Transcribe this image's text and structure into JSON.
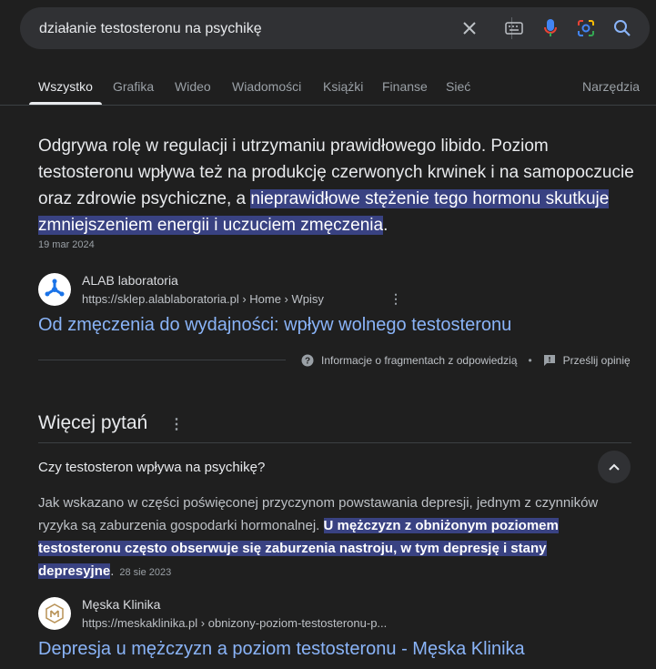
{
  "search": {
    "query": "działanie testosteronu na psychikę"
  },
  "tabs": [
    {
      "label": "Wszystko"
    },
    {
      "label": "Grafika"
    },
    {
      "label": "Wideo"
    },
    {
      "label": "Wiadomości"
    },
    {
      "label": "Książki"
    },
    {
      "label": "Finanse"
    },
    {
      "label": "Sieć"
    }
  ],
  "tools_label": "Narzędzia",
  "snippet": {
    "text_plain": "Odgrywa rolę w regulacji i utrzymaniu prawidłowego libido. Poziom testosteronu wpływa też na produkcję czerwonych krwinek i na samopoczucie oraz zdrowie psychiczne, a ",
    "text_highlight": "nieprawidłowe stężenie tego hormonu skutkuje zmniejszeniem energii i uczuciem zmęczenia",
    "text_end": ".",
    "date": "19 mar 2024"
  },
  "result1": {
    "site_name": "ALAB laboratoria",
    "url": "https://sklep.alablaboratoria.pl › Home › Wpisy",
    "title": "Od zmęczenia do wydajności: wpływ wolnego testosteronu",
    "logo_icon": "alab-logo-icon"
  },
  "feedback": {
    "info_label": "Informacje o fragmentach z odpowiedzią",
    "separator": "•",
    "send_label": "Prześlij opinię"
  },
  "more_questions": {
    "title": "Więcej pytań",
    "question": "Czy testosteron wpływa na psychikę?",
    "answer_plain": "Jak wskazano w części poświęconej przyczynom powstawania depresji, jednym z czynników ryzyka są zaburzenia gospodarki hormonalnej. ",
    "answer_highlight": "U mężczyzn z obniżonym poziomem testosteronu często obserwuje się zaburzenia nastroju, w tym depresję i stany depresyjne",
    "answer_end": ".",
    "date": "28 sie 2023"
  },
  "result2": {
    "site_name": "Męska Klinika",
    "url": "https://meskaklinika.pl › obnizony-poziom-testosteronu-p...",
    "title": "Depresja u mężczyzn a poziom testosteronu - Męska Klinika",
    "logo_icon": "meska-klinika-logo-icon"
  },
  "colors": {
    "background": "#1f1f1f",
    "link": "#8ab4f8",
    "highlight": "#394282"
  }
}
